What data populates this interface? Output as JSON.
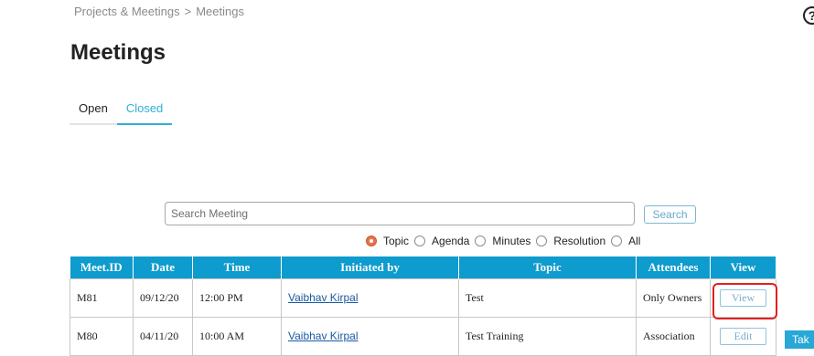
{
  "breadcrumb": {
    "parent": "Projects & Meetings",
    "separator": ">",
    "current": "Meetings"
  },
  "help_icon": {
    "icon": "help-circle-icon",
    "glyph": "?"
  },
  "page_title": "Meetings",
  "tabs": [
    {
      "label": "Open",
      "active": false
    },
    {
      "label": "Closed",
      "active": true
    }
  ],
  "search": {
    "placeholder": "Search Meeting",
    "value": "",
    "button_label": "Search"
  },
  "filter_options": [
    {
      "label": "Topic",
      "selected": true
    },
    {
      "label": "Agenda",
      "selected": false
    },
    {
      "label": "Minutes",
      "selected": false
    },
    {
      "label": "Resolution",
      "selected": false
    },
    {
      "label": "All",
      "selected": false
    }
  ],
  "table": {
    "columns": [
      "Meet.ID",
      "Date",
      "Time",
      "Initiated by",
      "Topic",
      "Attendees",
      "View"
    ],
    "rows": [
      {
        "id": "M81",
        "date": "09/12/20",
        "time": "12:00 PM",
        "initiated_by": "Vaibhav Kirpal",
        "topic": "Test",
        "attendees": "Only Owners",
        "action": "View"
      },
      {
        "id": "M80",
        "date": "04/11/20",
        "time": "10:00 AM",
        "initiated_by": "Vaibhav Kirpal",
        "topic": "Test Training",
        "attendees": "Association",
        "action": "Edit"
      }
    ]
  },
  "side_button_label": "Tak",
  "colors": {
    "accent": "#31b0d5",
    "table_header": "#0e9bcd",
    "highlight": "#e02020",
    "radio_selected": "#e8734a"
  }
}
